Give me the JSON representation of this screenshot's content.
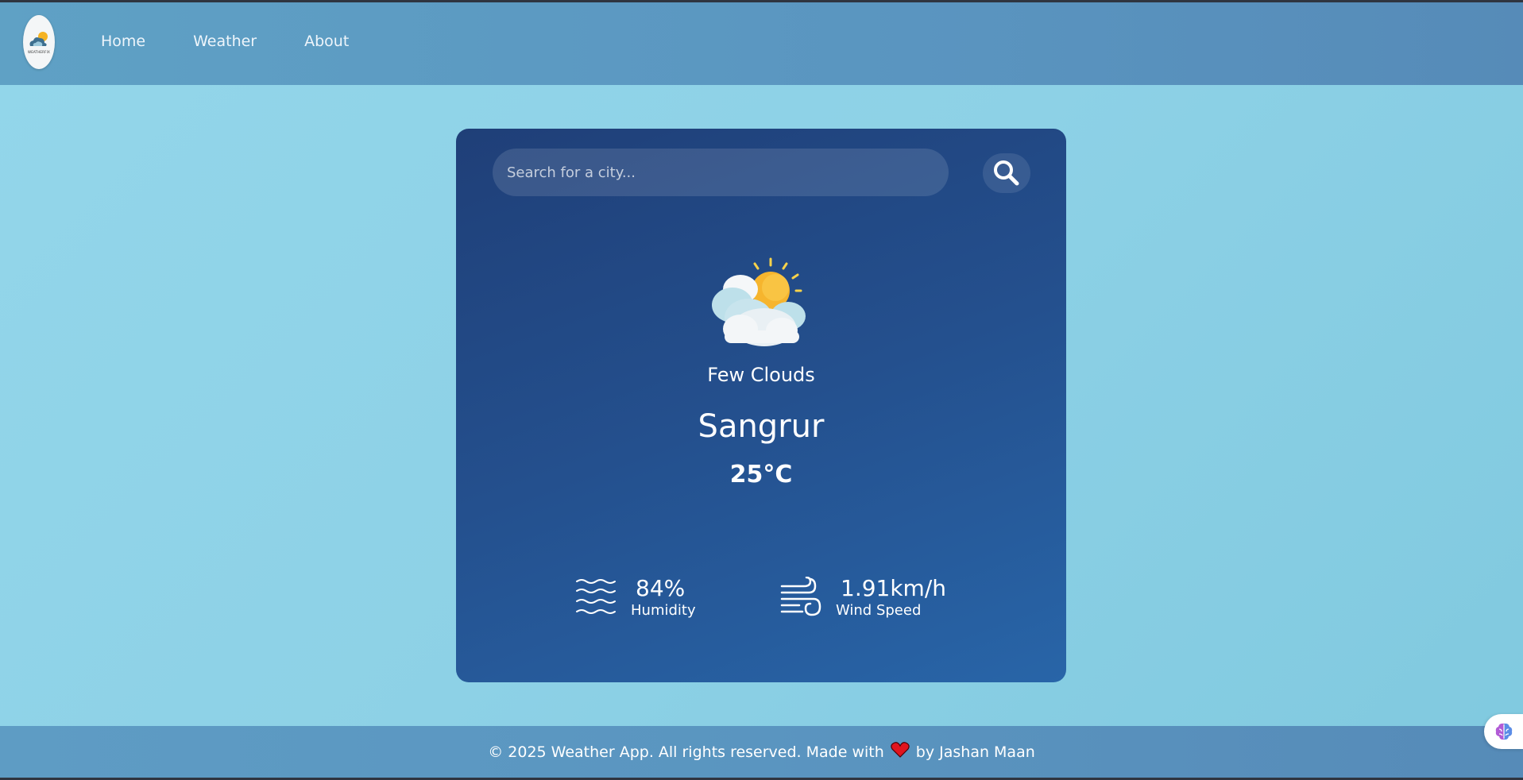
{
  "nav": {
    "logo_text": "WEATHERFIX",
    "links": [
      "Home",
      "Weather",
      "About"
    ]
  },
  "search": {
    "placeholder": "Search for a city..."
  },
  "weather": {
    "icon": "sun-behind-clouds-icon",
    "description": "Few Clouds",
    "city": "Sangrur",
    "temperature": "25°C"
  },
  "stats": {
    "humidity": {
      "value": "84%",
      "label": "Humidity",
      "icon": "waves-icon"
    },
    "wind": {
      "value": "1.91km/h",
      "label": "Wind Speed",
      "icon": "wind-icon"
    }
  },
  "footer": {
    "text_before": "© 2025 Weather App. All rights reserved. Made with",
    "text_after": "by Jashan Maan"
  },
  "colors": {
    "card_start": "#1f3f78",
    "card_end": "#2865a8",
    "navbar": "#5a95c0",
    "background": "#8dd1e6"
  }
}
